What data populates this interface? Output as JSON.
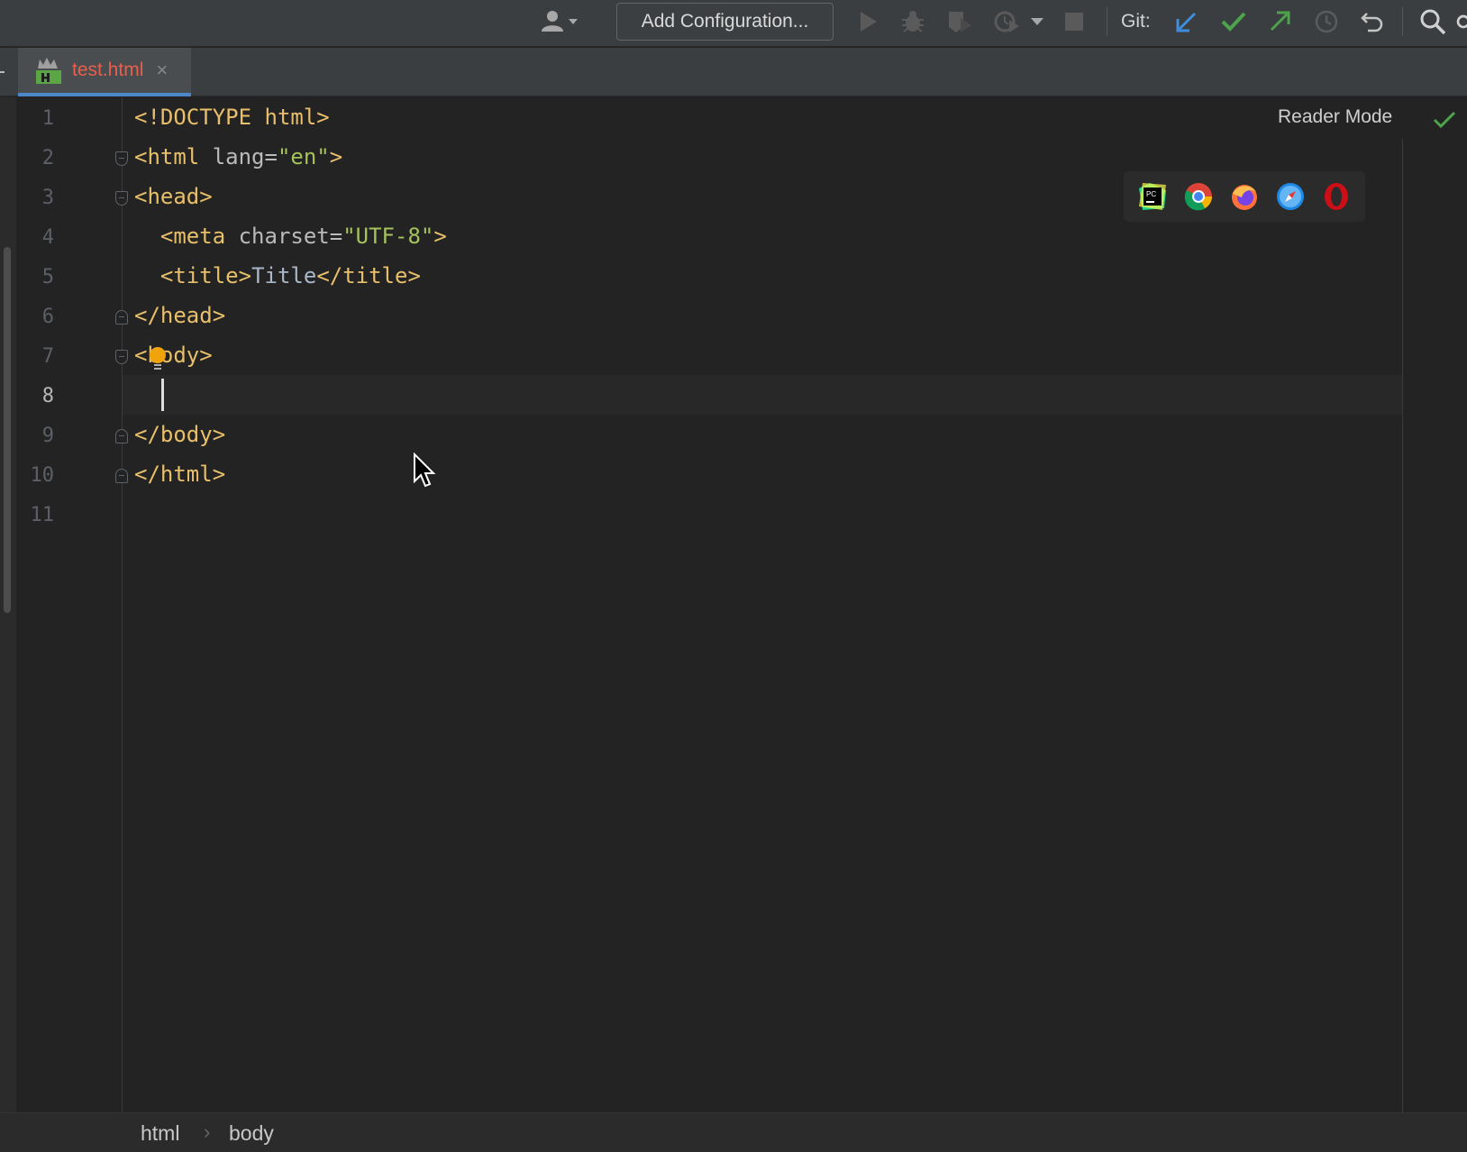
{
  "toolbar": {
    "add_configuration_label": "Add Configuration...",
    "git_label": "Git:",
    "icons": [
      "user-icon",
      "run-icon",
      "debug-icon",
      "coverage-icon",
      "profile-icon",
      "chevron-down-icon",
      "stop-icon",
      "git-update-icon",
      "git-commit-icon",
      "git-push-icon",
      "history-icon",
      "rollback-icon",
      "search-icon"
    ]
  },
  "tabs": [
    {
      "label": "test.html",
      "close": "×",
      "active": true
    }
  ],
  "editor": {
    "line_numbers": [
      "1",
      "2",
      "3",
      "4",
      "5",
      "6",
      "7",
      "8",
      "9",
      "10",
      "11"
    ],
    "current_line": "8",
    "reader_mode_label": "Reader Mode",
    "lines": {
      "l1": {
        "tag": "<!DOCTYPE html>"
      },
      "l2": {
        "open": "<html",
        "attr": " lang=",
        "val": "\"en\"",
        "close": ">"
      },
      "l3": {
        "tag": "<head>"
      },
      "l4": {
        "indent": "  ",
        "open": "<meta",
        "attr": " charset=",
        "val": "\"UTF-8\"",
        "close": ">"
      },
      "l5": {
        "indent": "  ",
        "open": "<title>",
        "text": "Title",
        "close": "</title>"
      },
      "l6": {
        "tag": "</head>"
      },
      "l7": {
        "tag": "<body>"
      },
      "l8": {
        "tag": ""
      },
      "l9": {
        "tag": "</body>"
      },
      "l10": {
        "tag": "</html>"
      },
      "l11": {
        "tag": ""
      }
    },
    "browsers": [
      "pycharm-icon",
      "chrome-icon",
      "firefox-icon",
      "safari-icon",
      "opera-icon"
    ]
  },
  "breadcrumbs": {
    "items": [
      "html",
      "body"
    ],
    "separator": "›"
  },
  "colors": {
    "tag": "#e8bf6a",
    "value": "#a5c25c",
    "attribute": "#bababa",
    "tab_active_text": "#e8604c",
    "accent": "#4a88c7"
  }
}
